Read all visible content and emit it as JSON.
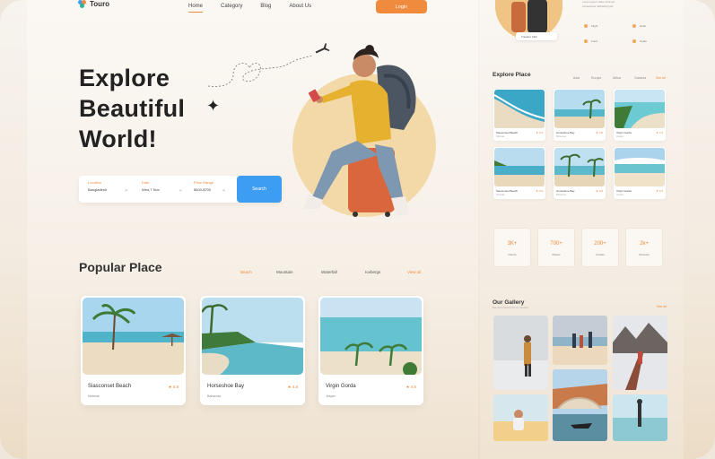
{
  "nav": {
    "logo": "Touro",
    "links": [
      {
        "label": "Home",
        "active": true
      },
      {
        "label": "Category",
        "active": false
      },
      {
        "label": "Blog",
        "active": false
      },
      {
        "label": "About Us",
        "active": false
      }
    ],
    "login": "Login"
  },
  "hero": {
    "title_lines": [
      "Explore",
      "Beautiful",
      "World!"
    ]
  },
  "search": {
    "location_label": "Location",
    "location_value": "Bangladesh",
    "date_label": "Date",
    "date_value": "Wed,7 Nov",
    "price_label": "Price Range",
    "price_value": "$400-$700",
    "button": "Search"
  },
  "popular": {
    "title": "Popular Place",
    "filters": [
      {
        "label": "Beach",
        "active": true
      },
      {
        "label": "Mountain",
        "active": false
      },
      {
        "label": "Waterfall",
        "active": false
      },
      {
        "label": "Icebergs",
        "active": false
      }
    ],
    "view_all": "View all",
    "cards": [
      {
        "name": "Siasconset Beach",
        "rating": "★ 4.9",
        "location": "Nobeda"
      },
      {
        "name": "Horseshoe Bay",
        "rating": "★ 4.8",
        "location": "Bahamas"
      },
      {
        "name": "Virgin Gorda",
        "rating": "★ 4.5",
        "location": "Jesper"
      }
    ]
  },
  "right": {
    "mini_chip": "Traveler Club",
    "mini_text": [
      "Lorem ipsum dolor sit amet",
      "consectetur adipiscing elit"
    ],
    "features": [
      "Flight",
      "Hotel",
      "Food",
      "Guide"
    ],
    "explore_title": "Explore Place",
    "explore_tabs": [
      {
        "label": "Asia",
        "active": false
      },
      {
        "label": "Europe",
        "active": false
      },
      {
        "label": "Africa",
        "active": false
      },
      {
        "label": "Oceania",
        "active": false
      },
      {
        "label": "See all",
        "active": true
      }
    ],
    "explore_cards": [
      {
        "name": "Siasconset Beach",
        "rating": "★ 4.9",
        "location": "Nobeda"
      },
      {
        "name": "Horseshoe Bay",
        "rating": "★ 4.8",
        "location": "Bahamas"
      },
      {
        "name": "Virgin Gorda",
        "rating": "★ 4.5",
        "location": "Jesper"
      },
      {
        "name": "Siasconset Beach",
        "rating": "★ 4.9",
        "location": "Nobeda"
      },
      {
        "name": "Horseshoe Bay",
        "rating": "★ 4.8",
        "location": "Bahamas"
      },
      {
        "name": "Virgin Gorda",
        "rating": "★ 4.5",
        "location": "Jesper"
      }
    ],
    "stats": [
      {
        "value": "3K+",
        "label": "Clients"
      },
      {
        "value": "700+",
        "label": "Places"
      },
      {
        "value": "200+",
        "label": "Guides"
      },
      {
        "value": "2k+",
        "label": "Reviews"
      }
    ],
    "gallery_title": "Our Gallery",
    "gallery_sub": "Moments captured by our travelers",
    "gallery_link": "See all"
  },
  "colors": {
    "accent": "#f08a3c",
    "search_button": "#3d9df0",
    "hero_circle": "#f3d9a8"
  }
}
